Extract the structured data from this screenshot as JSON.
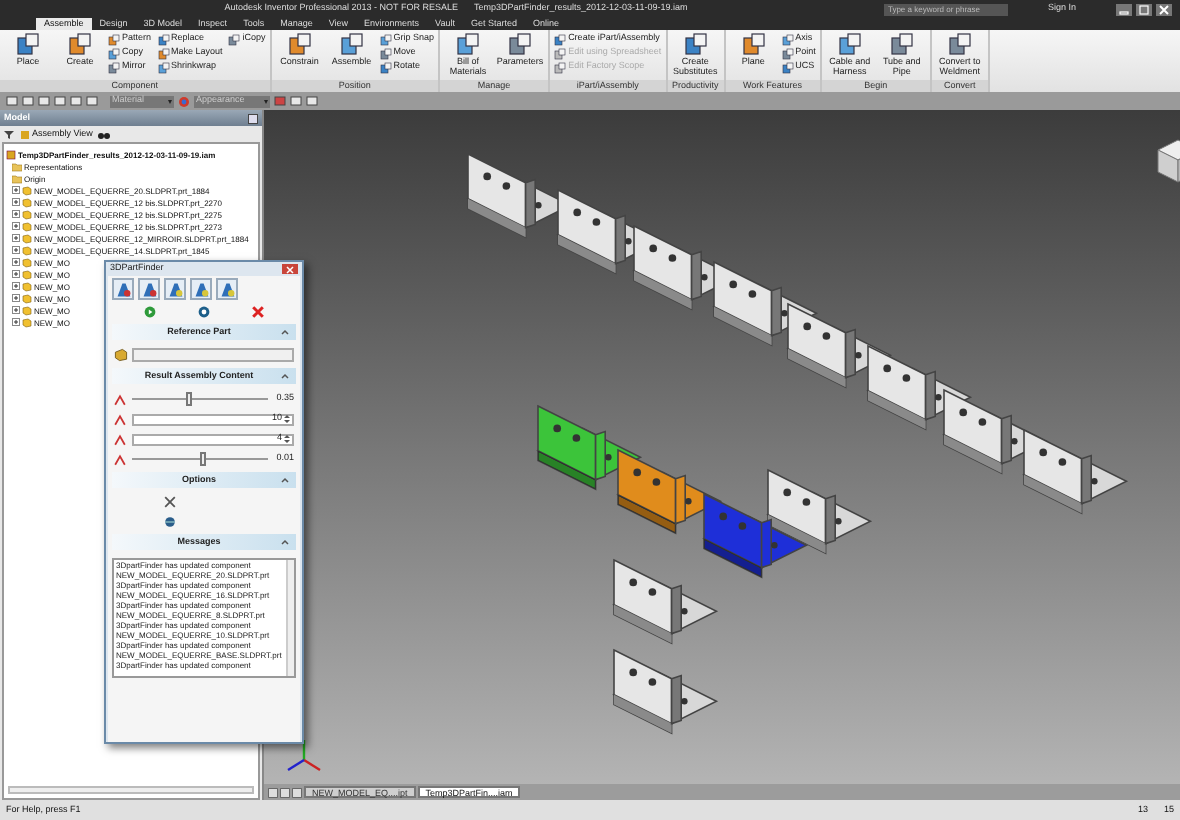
{
  "window": {
    "title": "Autodesk Inventor Professional 2013 - NOT FOR RESALE",
    "document": "Temp3DPartFinder_results_2012-12-03-11-09-19.iam"
  },
  "search": {
    "placeholder": "Type a keyword or phrase"
  },
  "sign_in": "Sign In",
  "tabs": [
    {
      "label": "Assemble",
      "selected": true
    },
    {
      "label": "Design",
      "selected": false
    },
    {
      "label": "3D Model",
      "selected": false
    },
    {
      "label": "Inspect",
      "selected": false
    },
    {
      "label": "Tools",
      "selected": false
    },
    {
      "label": "Manage",
      "selected": false
    },
    {
      "label": "View",
      "selected": false
    },
    {
      "label": "Environments",
      "selected": false
    },
    {
      "label": "Vault",
      "selected": false
    },
    {
      "label": "Get Started",
      "selected": false
    },
    {
      "label": "Online",
      "selected": false
    }
  ],
  "ribbon_groups": [
    {
      "title": "Component",
      "buttons": [
        {
          "label": "Place",
          "kind": "large",
          "disabled": false
        },
        {
          "label": "Create",
          "kind": "large",
          "disabled": false
        },
        {
          "label": "Pattern",
          "kind": "small",
          "disabled": false
        },
        {
          "label": "Copy",
          "kind": "small",
          "disabled": false
        },
        {
          "label": "Mirror",
          "kind": "small",
          "disabled": false
        },
        {
          "label": "Replace",
          "kind": "small",
          "disabled": false
        },
        {
          "label": "Make Layout",
          "kind": "small",
          "disabled": false
        },
        {
          "label": "Shrinkwrap",
          "kind": "small",
          "disabled": false
        },
        {
          "label": "iCopy",
          "kind": "small",
          "disabled": false
        }
      ]
    },
    {
      "title": "Position",
      "buttons": [
        {
          "label": "Constrain",
          "kind": "large",
          "disabled": false
        },
        {
          "label": "Assemble",
          "kind": "large",
          "disabled": false
        },
        {
          "label": "Grip Snap",
          "kind": "small",
          "disabled": false
        },
        {
          "label": "Move",
          "kind": "small",
          "disabled": false
        },
        {
          "label": "Rotate",
          "kind": "small",
          "disabled": false
        }
      ]
    },
    {
      "title": "Manage",
      "buttons": [
        {
          "label": "Bill of Materials",
          "kind": "large",
          "disabled": false
        },
        {
          "label": "Parameters",
          "kind": "large",
          "disabled": false
        }
      ]
    },
    {
      "title": "iPart/iAssembly",
      "buttons": [
        {
          "label": "Create iPart/iAssembly",
          "kind": "small",
          "disabled": false
        },
        {
          "label": "Edit using Spreadsheet",
          "kind": "small",
          "disabled": true
        },
        {
          "label": "Edit Factory Scope",
          "kind": "small",
          "disabled": true
        }
      ]
    },
    {
      "title": "Productivity",
      "buttons": [
        {
          "label": "Create Substitutes",
          "kind": "large",
          "disabled": false
        }
      ]
    },
    {
      "title": "Work Features",
      "buttons": [
        {
          "label": "Plane",
          "kind": "large",
          "disabled": false
        },
        {
          "label": "Axis",
          "kind": "small",
          "disabled": false
        },
        {
          "label": "Point",
          "kind": "small",
          "disabled": false
        },
        {
          "label": "UCS",
          "kind": "small",
          "disabled": false
        }
      ]
    },
    {
      "title": "Begin",
      "buttons": [
        {
          "label": "Cable and Harness",
          "kind": "large",
          "disabled": false
        },
        {
          "label": "Tube and Pipe",
          "kind": "large",
          "disabled": false
        }
      ]
    },
    {
      "title": "Convert",
      "buttons": [
        {
          "label": "Convert to Weldment",
          "kind": "large",
          "disabled": false
        }
      ]
    }
  ],
  "quick_access": {
    "material": "Material",
    "appearance": "Appearance"
  },
  "browser": {
    "title": "Model",
    "view": "Assembly View",
    "tree": {
      "label": "Temp3DPartFinder_results_2012-12-03-11-09-19.iam",
      "children": [
        {
          "label": "Representations",
          "kind": "folder"
        },
        {
          "label": "Origin",
          "kind": "folder"
        },
        {
          "label": "NEW_MODEL_EQUERRE_20.SLDPRT.prt_1884",
          "kind": "part"
        },
        {
          "label": "NEW_MODEL_EQUERRE_12 bis.SLDPRT.prt_2270",
          "kind": "part"
        },
        {
          "label": "NEW_MODEL_EQUERRE_12 bis.SLDPRT.prt_2275",
          "kind": "part"
        },
        {
          "label": "NEW_MODEL_EQUERRE_12 bis.SLDPRT.prt_2273",
          "kind": "part"
        },
        {
          "label": "NEW_MODEL_EQUERRE_12_MIRROIR.SLDPRT.prt_1884",
          "kind": "part"
        },
        {
          "label": "NEW_MODEL_EQUERRE_14.SLDPRT.prt_1845",
          "kind": "part"
        },
        {
          "label": "NEW_MO",
          "kind": "part"
        },
        {
          "label": "NEW_MO",
          "kind": "part"
        },
        {
          "label": "NEW_MO",
          "kind": "part"
        },
        {
          "label": "NEW_MO",
          "kind": "part"
        },
        {
          "label": "NEW_MO",
          "kind": "part"
        },
        {
          "label": "NEW_MO",
          "kind": "part"
        }
      ]
    }
  },
  "finder": {
    "title": "3DPartFinder",
    "sections": [
      {
        "kind": "reference",
        "title": "Reference Part",
        "expanded": true
      },
      {
        "kind": "result",
        "title": "Result Assembly Content",
        "expanded": true,
        "controls": [
          {
            "kind": "slider",
            "level": 0.4,
            "reading": "0.35"
          },
          {
            "kind": "spin",
            "value": "10"
          },
          {
            "kind": "spin",
            "value": "4"
          },
          {
            "kind": "slider",
            "level": 0.5,
            "reading": "0.01"
          }
        ]
      },
      {
        "kind": "options",
        "title": "Options",
        "expanded": true
      },
      {
        "kind": "messages",
        "title": "Messages",
        "expanded": true,
        "lines": [
          "3DpartFinder has updated component",
          "NEW_MODEL_EQUERRE_20.SLDPRT.prt",
          "3DpartFinder has updated component",
          "NEW_MODEL_EQUERRE_16.SLDPRT.prt",
          "3DpartFinder has updated component",
          "NEW_MODEL_EQUERRE_8.SLDPRT.prt",
          "3DpartFinder has updated component",
          "NEW_MODEL_EQUERRE_10.SLDPRT.prt",
          "3DpartFinder has updated component",
          "NEW_MODEL_EQUERRE_BASE.SLDPRT.prt",
          "3DpartFinder has updated component"
        ]
      }
    ]
  },
  "document_tabs": [
    {
      "label": "NEW_MODEL_EQ....ipt",
      "selected": false
    },
    {
      "label": "Temp3DPartFin....iam",
      "selected": true
    }
  ],
  "status_bar": {
    "help": "For Help, press F1",
    "count_1": "13",
    "count_2": "15"
  }
}
